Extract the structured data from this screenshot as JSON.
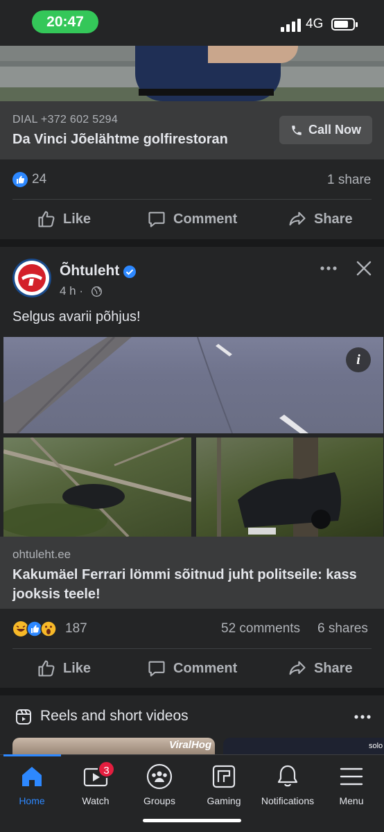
{
  "status_bar": {
    "time": "20:47",
    "network": "4G"
  },
  "ad": {
    "dial_text": "DIAL +372 602 5294",
    "business_name": "Da Vinci Jõelähtme golfirestoran",
    "cta_label": "Call Now"
  },
  "post1": {
    "reaction_count": "24",
    "shares": "1 share",
    "actions": {
      "like": "Like",
      "comment": "Comment",
      "share": "Share"
    }
  },
  "post2": {
    "page_name": "Õhtuleht",
    "time": "4 h ·",
    "text": "Selgus avarii põhjus!",
    "link_domain": "ohtuleht.ee",
    "link_title": "Kakumäel Ferrari lömmi sõitnud juht politseile: kass jooksis teele!",
    "reaction_count": "187",
    "comments": "52 comments",
    "shares": "6 shares",
    "actions": {
      "like": "Like",
      "comment": "Comment",
      "share": "Share"
    }
  },
  "reels": {
    "title": "Reels and short videos",
    "thumb1_label": "ViralHog",
    "thumb2_label": "solo"
  },
  "tabbar": {
    "tabs": [
      {
        "label": "Home",
        "icon": "home-icon",
        "active": true
      },
      {
        "label": "Watch",
        "icon": "watch-icon",
        "badge": "3"
      },
      {
        "label": "Groups",
        "icon": "groups-icon"
      },
      {
        "label": "Gaming",
        "icon": "gaming-icon"
      },
      {
        "label": "Notifications",
        "icon": "bell-icon"
      },
      {
        "label": "Menu",
        "icon": "menu-icon"
      }
    ]
  },
  "colors": {
    "accent": "#2d88ff",
    "badge": "#e41e3f",
    "status_pill": "#34c759"
  }
}
